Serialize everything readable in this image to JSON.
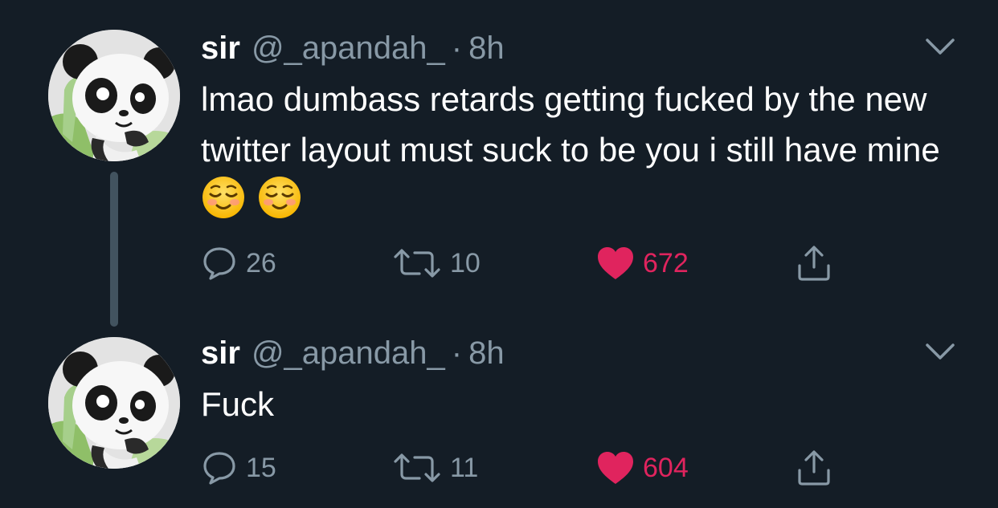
{
  "colors": {
    "background": "#141d26",
    "muted": "#8899a6",
    "like": "#e0245e",
    "thread_line": "#42535f"
  },
  "tweets": [
    {
      "name": "sir",
      "handle": "@_apandah_",
      "separator": "·",
      "time": "8h",
      "text": "lmao dumbass retards getting fucked by the new twitter layout must suck to be you i still have mine",
      "emoji": [
        "smiling-face-emoji",
        "smiling-face-emoji"
      ],
      "replies": "26",
      "retweets": "10",
      "likes": "672",
      "liked": true
    },
    {
      "name": "sir",
      "handle": "@_apandah_",
      "separator": "·",
      "time": "8h",
      "text": "Fuck",
      "replies": "15",
      "retweets": "11",
      "likes": "604",
      "liked": true
    }
  ]
}
